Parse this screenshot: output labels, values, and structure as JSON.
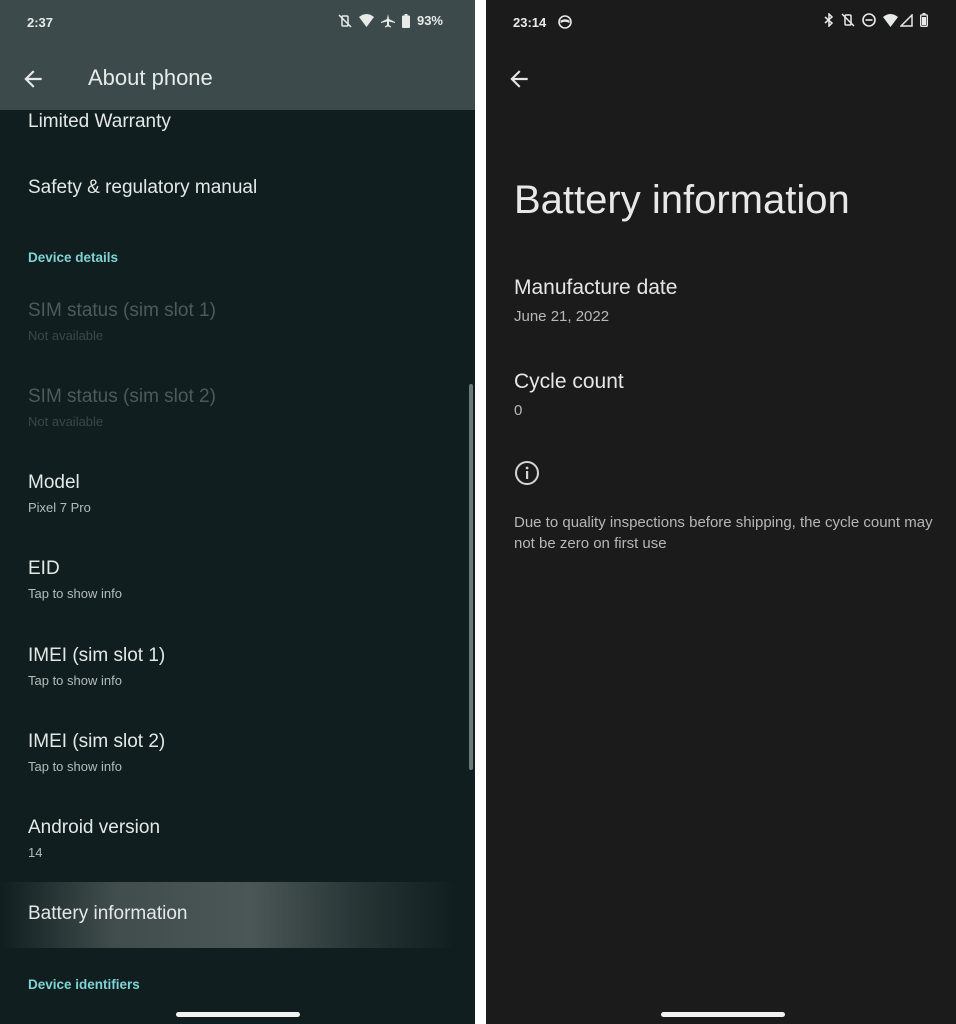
{
  "left_screen": {
    "status_bar": {
      "time": "2:37",
      "icons": [
        "vibrate-off-icon",
        "wifi-icon",
        "airplane-icon",
        "battery-icon"
      ],
      "battery_percent": "93%"
    },
    "app_bar": {
      "back_icon": "arrow-back-icon",
      "title": "About phone"
    },
    "items": [
      {
        "title": "Limited Warranty",
        "subtitle": null,
        "enabled": true
      },
      {
        "title": "Safety & regulatory manual",
        "subtitle": null,
        "enabled": true
      }
    ],
    "section_device_details": "Device details",
    "device_items": [
      {
        "title": "SIM status (sim slot 1)",
        "subtitle": "Not available",
        "enabled": false
      },
      {
        "title": "SIM status (sim slot 2)",
        "subtitle": "Not available",
        "enabled": false
      },
      {
        "title": "Model",
        "subtitle": "Pixel 7 Pro",
        "enabled": true
      },
      {
        "title": "EID",
        "subtitle": "Tap to show info",
        "enabled": true
      },
      {
        "title": "IMEI (sim slot 1)",
        "subtitle": "Tap to show info",
        "enabled": true
      },
      {
        "title": "IMEI (sim slot 2)",
        "subtitle": "Tap to show info",
        "enabled": true
      },
      {
        "title": "Android version",
        "subtitle": "14",
        "enabled": true
      },
      {
        "title": "Battery information",
        "subtitle": null,
        "enabled": true,
        "highlighted": true
      }
    ],
    "section_device_identifiers": "Device identifiers",
    "accent_color": "#7fd3d3"
  },
  "right_screen": {
    "status_bar": {
      "time": "23:14",
      "left_icons": [
        "notification-face-icon"
      ],
      "icons": [
        "bluetooth-icon",
        "vibrate-off-icon",
        "do-not-disturb-icon",
        "wifi-icon",
        "signal-icon",
        "battery-icon"
      ]
    },
    "back_icon": "arrow-back-icon",
    "title": "Battery information",
    "items": [
      {
        "title": "Manufacture date",
        "value": "June 21, 2022"
      },
      {
        "title": "Cycle count",
        "value": "0"
      }
    ],
    "info_icon": "info-icon",
    "note": "Due to quality inspections before shipping, the cycle count may not be zero on first use"
  }
}
